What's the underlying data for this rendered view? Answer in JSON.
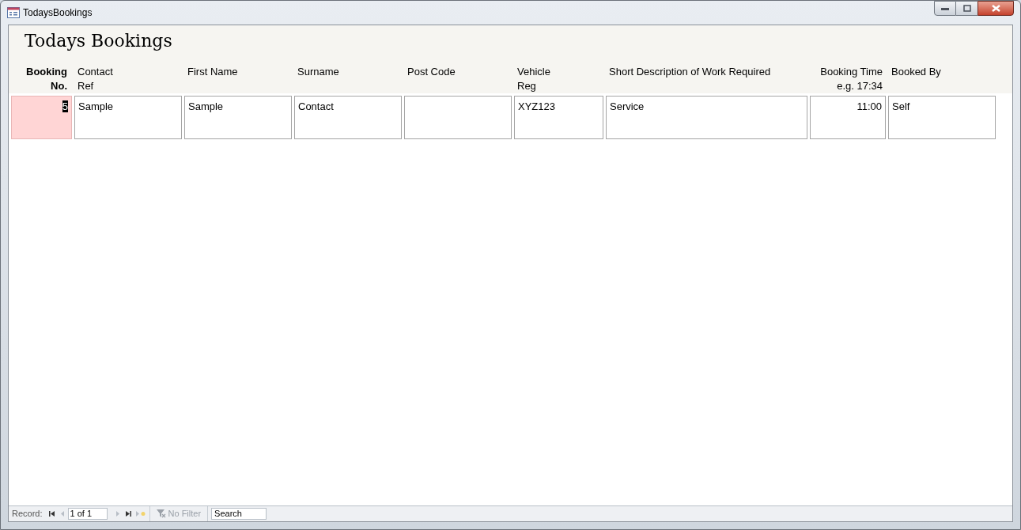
{
  "window": {
    "title": "TodaysBookings"
  },
  "form": {
    "title": "Todays Bookings"
  },
  "columns": [
    {
      "kind": "key",
      "label": "Booking\nNo.",
      "value": "5",
      "text_selected": true
    },
    {
      "kind": "text",
      "label": "Contact\nRef",
      "value": "Sample"
    },
    {
      "kind": "text",
      "label": "First Name",
      "value": "Sample"
    },
    {
      "kind": "text",
      "label": "Surname",
      "value": "Contact"
    },
    {
      "kind": "text",
      "label": "Post Code"
    },
    {
      "kind": "text",
      "label": "Vehicle\nReg",
      "value": "XYZ123"
    },
    {
      "kind": "text",
      "label": "Short Description of Work Required",
      "value": "Service"
    },
    {
      "kind": "time",
      "label": "Booking Time\ne.g. 17:34",
      "value": "11:00"
    },
    {
      "kind": "text",
      "label": "Booked By",
      "value": "Self"
    }
  ],
  "navigation": {
    "label": "Record:",
    "position": "1 of 1",
    "first_disabled": false,
    "prev_disabled": true,
    "next_disabled": true,
    "last_disabled": false,
    "new_disabled": true,
    "filter": {
      "label": "No Filter",
      "disabled": true
    },
    "search": {
      "placeholder": "Search"
    }
  }
}
